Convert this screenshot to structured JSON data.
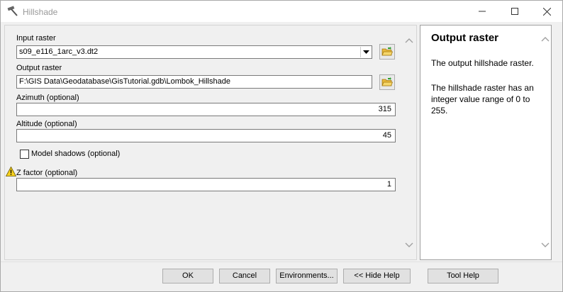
{
  "window": {
    "title": "Hillshade",
    "icon": "hammer-icon"
  },
  "form": {
    "input_raster": {
      "label": "Input raster",
      "value": "s09_e116_1arc_v3.dt2"
    },
    "output_raster": {
      "label": "Output raster",
      "value": "F:\\GIS Data\\Geodatabase\\GisTutorial.gdb\\Lombok_Hillshade"
    },
    "azimuth": {
      "label": "Azimuth (optional)",
      "value": "315"
    },
    "altitude": {
      "label": "Altitude (optional)",
      "value": "45"
    },
    "model_shadows": {
      "label": "Model shadows (optional)",
      "checked": false
    },
    "z_factor": {
      "label": "Z factor (optional)",
      "value": "1",
      "warning_icon": "warning-icon"
    }
  },
  "help": {
    "title": "Output raster",
    "paragraph1": "The output hillshade raster.",
    "paragraph2": "The hillshade raster has an integer value range of 0 to 255."
  },
  "buttons": {
    "ok": "OK",
    "cancel": "Cancel",
    "environments": "Environments...",
    "hide_help": "<< Hide Help",
    "tool_help": "Tool Help"
  },
  "colors": {
    "window_bg": "#f0f0f0",
    "warning": "#f7d11e"
  }
}
